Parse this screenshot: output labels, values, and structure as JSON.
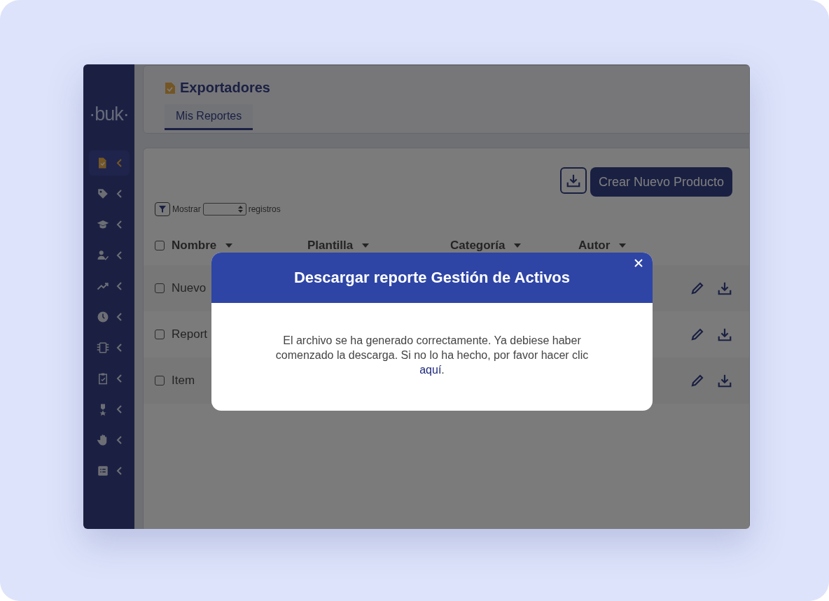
{
  "sidebar": {
    "logo": "·buk·",
    "items": [
      {
        "selected": true
      },
      {
        "selected": false
      },
      {
        "selected": false
      },
      {
        "selected": false
      },
      {
        "selected": false
      },
      {
        "selected": false
      },
      {
        "selected": false
      },
      {
        "selected": false
      },
      {
        "selected": false
      },
      {
        "selected": false
      },
      {
        "selected": false
      }
    ]
  },
  "header": {
    "title": "Exportadores",
    "tabs": [
      {
        "label": "Mis Reportes",
        "selected": true
      }
    ]
  },
  "toolbar": {
    "create_button": "Crear Nuevo Producto"
  },
  "filter": {
    "show_label": "Mostrar",
    "records_label": "registros"
  },
  "table": {
    "header_checked": false,
    "columns": [
      "Nombre",
      "Plantilla",
      "Categoría",
      "Autor"
    ],
    "rows": [
      {
        "name": "Nuevo",
        "checked": false
      },
      {
        "name": "Report",
        "checked": false
      },
      {
        "name": "Item",
        "checked": false
      }
    ]
  },
  "modal": {
    "title": "Descargar reporte Gestión de Activos",
    "message": "El archivo se ha generado correctamente. Ya debiese haber comenzado la descarga. Si no lo ha hecho, por favor hacer clic",
    "link": "aquí",
    "after_link": "."
  }
}
